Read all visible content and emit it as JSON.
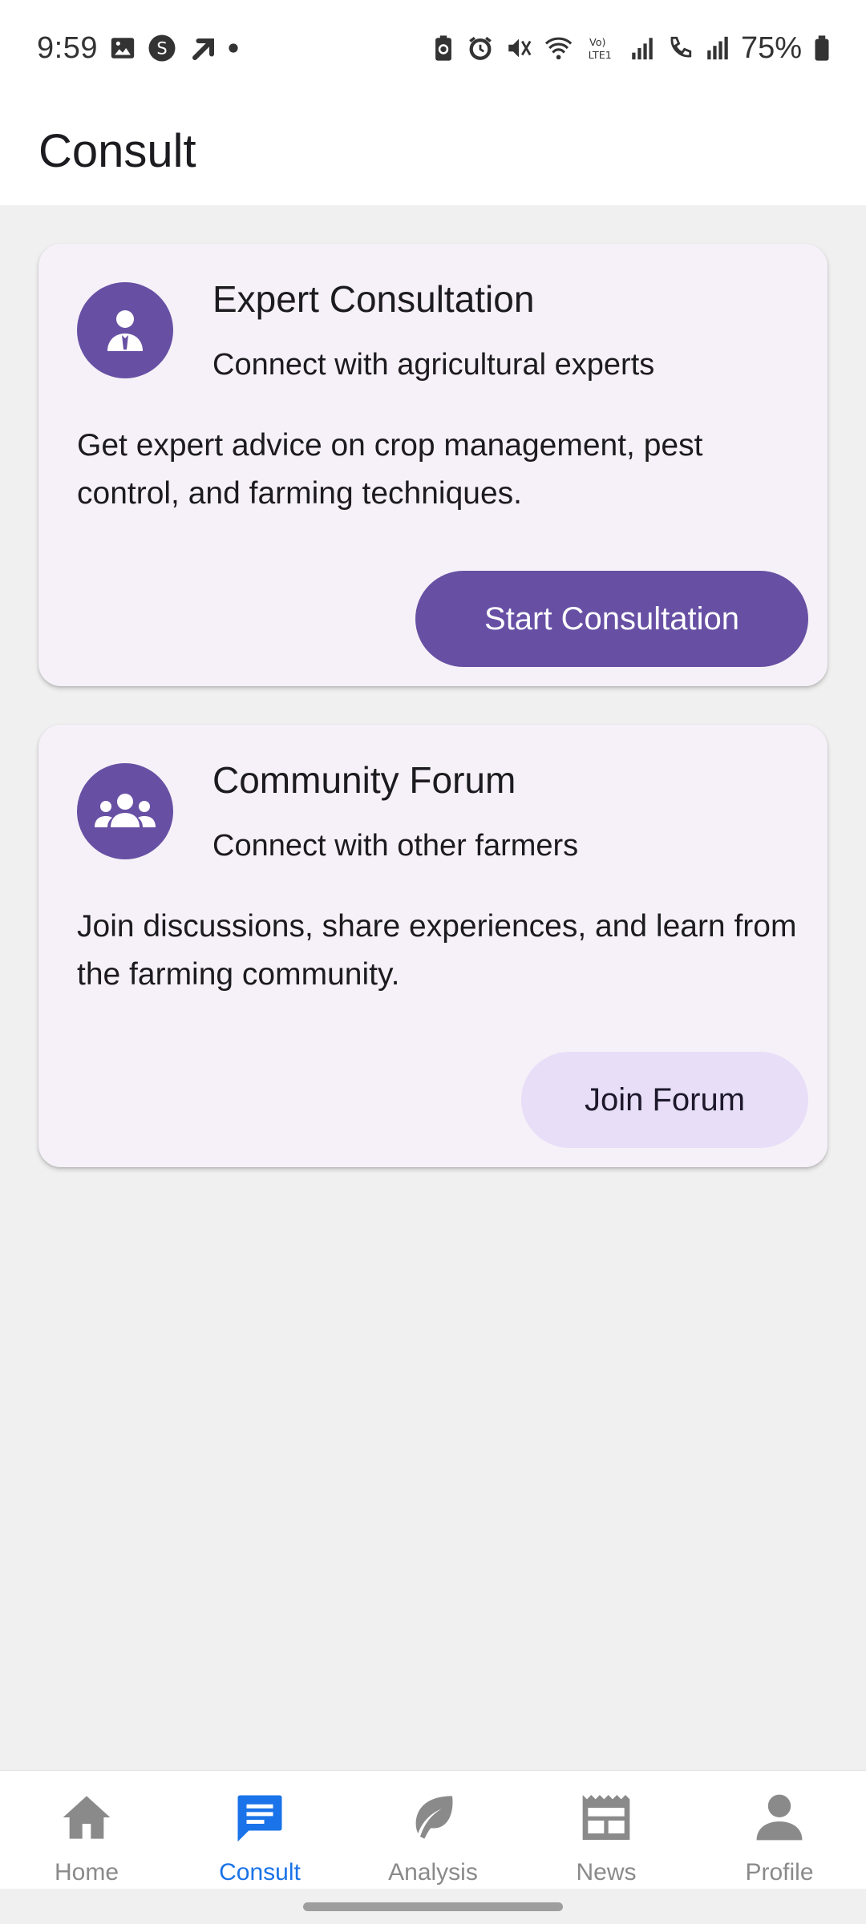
{
  "status_bar": {
    "time": "9:59",
    "battery": "75%",
    "icons_left": [
      "gallery-icon",
      "s-icon",
      "arrow-up-right-icon",
      "dot-icon"
    ],
    "icons_right": [
      "battery-saver-icon",
      "alarm-icon",
      "mute-icon",
      "wifi-icon",
      "volte-icon",
      "signal-icon",
      "wifi-call-icon",
      "signal2-icon",
      "battery-icon"
    ]
  },
  "app_bar": {
    "title": "Consult"
  },
  "cards": [
    {
      "icon": "expert-person-icon",
      "title": "Expert Consultation",
      "subtitle": "Connect with agricultural experts",
      "body": "Get expert advice on crop management, pest control, and farming techniques.",
      "button": "Start Consultation"
    },
    {
      "icon": "group-icon",
      "title": "Community Forum",
      "subtitle": "Connect with other farmers",
      "body": "Join discussions, share experiences, and learn from the farming community.",
      "button": "Join Forum"
    }
  ],
  "nav": {
    "items": [
      {
        "label": "Home",
        "icon": "home-icon"
      },
      {
        "label": "Consult",
        "icon": "chat-icon",
        "active": true
      },
      {
        "label": "Analysis",
        "icon": "leaf-icon"
      },
      {
        "label": "News",
        "icon": "newspaper-icon"
      },
      {
        "label": "Profile",
        "icon": "person-icon"
      }
    ]
  },
  "colors": {
    "primary": "#6750a4",
    "tonal": "#e8def8",
    "card_bg": "#f6f1f8",
    "nav_active": "#1a73e8",
    "nav_inactive": "#8a8a8a"
  }
}
